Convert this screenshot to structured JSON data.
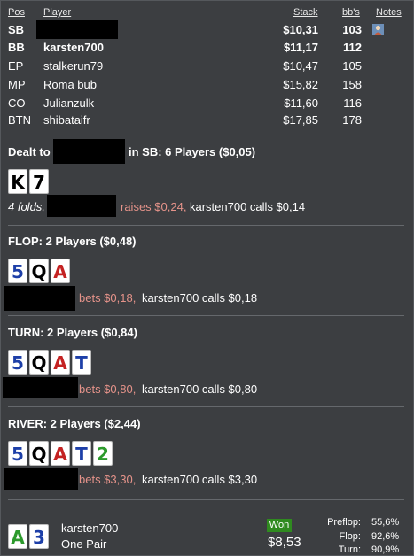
{
  "table_header": {
    "pos": "Pos",
    "player": "Player",
    "stack": "Stack",
    "bbs": "bb's",
    "notes": "Notes"
  },
  "players": [
    {
      "pos": "SB",
      "name": "",
      "stack": "$10,31",
      "bbs": "103",
      "bold": true,
      "redacted": true,
      "note_icon": "player-note-icon"
    },
    {
      "pos": "BB",
      "name": "karsten700",
      "stack": "$11,17",
      "bbs": "112",
      "bold": true
    },
    {
      "pos": "EP",
      "name": "stalkerun79",
      "stack": "$10,47",
      "bbs": "105"
    },
    {
      "pos": "MP",
      "name": "Roma bub",
      "stack": "$15,82",
      "bbs": "158"
    },
    {
      "pos": "CO",
      "name": "Julianzulk",
      "stack": "$11,60",
      "bbs": "116"
    },
    {
      "pos": "BTN",
      "name": "shibataifr",
      "stack": "$17,85",
      "bbs": "178"
    }
  ],
  "preflop": {
    "dealt_prefix": "Dealt to",
    "dealt_suffix": "in SB: 6 Players ($0,05)",
    "hole_cards": [
      {
        "rank": "K",
        "suit_color": "black"
      },
      {
        "rank": "7",
        "suit_color": "black"
      }
    ],
    "folds": "4 folds,",
    "raise_text": "raises $0,24,",
    "call_text": "karsten700 calls $0,14"
  },
  "flop": {
    "title": "FLOP: 2 Players ($0,48)",
    "cards": [
      {
        "rank": "5",
        "suit_color": "blue"
      },
      {
        "rank": "Q",
        "suit_color": "black"
      },
      {
        "rank": "A",
        "suit_color": "red"
      }
    ],
    "bet_text": "bets $0,18,",
    "call_text": "karsten700 calls $0,18"
  },
  "turn": {
    "title": "TURN: 2 Players ($0,84)",
    "cards": [
      {
        "rank": "5",
        "suit_color": "blue"
      },
      {
        "rank": "Q",
        "suit_color": "black"
      },
      {
        "rank": "A",
        "suit_color": "red"
      },
      {
        "rank": "T",
        "suit_color": "blue"
      }
    ],
    "bet_text": "bets $0,80,",
    "call_text": "karsten700 calls $0,80"
  },
  "river": {
    "title": "RIVER: 2 Players ($2,44)",
    "cards": [
      {
        "rank": "5",
        "suit_color": "blue"
      },
      {
        "rank": "Q",
        "suit_color": "black"
      },
      {
        "rank": "A",
        "suit_color": "red"
      },
      {
        "rank": "T",
        "suit_color": "blue"
      },
      {
        "rank": "2",
        "suit_color": "green"
      }
    ],
    "bet_text": "bets $3,30,",
    "call_text": "karsten700 calls $3,30"
  },
  "showdown": {
    "cards": [
      {
        "rank": "A",
        "suit_color": "green"
      },
      {
        "rank": "3",
        "suit_color": "blue"
      }
    ],
    "player": "karsten700",
    "hand": "One Pair",
    "won_label": "Won",
    "won_amount": "$8,53",
    "equity": [
      {
        "label": "Preflop:",
        "value": "55,6%"
      },
      {
        "label": "Flop:",
        "value": "92,6%"
      },
      {
        "label": "Turn:",
        "value": "90,9%"
      }
    ]
  },
  "colors": {
    "background": "#3c3e41",
    "hero_action": "#e5938a",
    "won_badge": "#2f8a1f",
    "card_red": "#c42222",
    "card_blue": "#1d3fa8",
    "card_green": "#2c9a2c",
    "card_black": "#000000"
  }
}
